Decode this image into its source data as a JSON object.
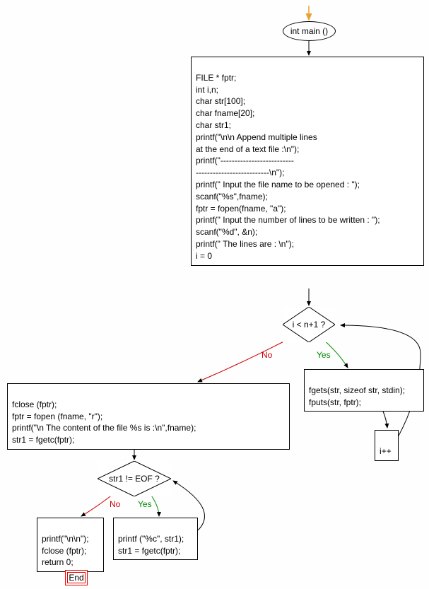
{
  "chart_data": {
    "type": "flowchart",
    "title": "C Program Flowchart: Append multiple lines at the end of a text file",
    "nodes": [
      {
        "id": "start",
        "type": "start-arrow"
      },
      {
        "id": "main",
        "type": "ellipse",
        "label": "int main ()"
      },
      {
        "id": "init",
        "type": "process",
        "label": "FILE * fptr;\nint i,n;\nchar str[100];\nchar fname[20];\nchar str1;\nprintf(\"\\n\\n Append multiple lines\nat the end of a text file :\\n\");\nprintf(\"--------------------------\n--------------------------\\n\");\nprintf(\" Input the file name to be opened : \");\nscanf(\"%s\",fname);\nfptr = fopen(fname, \"a\");\nprintf(\" Input the number of lines to be written : \");\nscanf(\"%d\", &n);\nprintf(\" The lines are : \\n\");\ni = 0"
      },
      {
        "id": "cond1",
        "type": "decision",
        "label": "i < n+1 ?"
      },
      {
        "id": "loop1",
        "type": "process",
        "label": "fgets(str, sizeof str, stdin);\nfputs(str, fptr);"
      },
      {
        "id": "incr",
        "type": "process",
        "label": "i++"
      },
      {
        "id": "afterloop",
        "type": "process",
        "label": "fclose (fptr);\nfptr = fopen (fname, \"r\");\nprintf(\"\\n The content of the file %s is  :\\n\",fname);\nstr1 = fgetc(fptr);"
      },
      {
        "id": "cond2",
        "type": "decision",
        "label": "str1 != EOF ?"
      },
      {
        "id": "loop2",
        "type": "process",
        "label": "printf (\"%c\", str1);\nstr1 = fgetc(fptr);"
      },
      {
        "id": "final",
        "type": "process",
        "label": "printf(\"\\n\\n\");\nfclose (fptr);\nreturn 0;"
      },
      {
        "id": "end",
        "type": "terminator",
        "label": "End"
      }
    ],
    "edges": [
      {
        "from": "start",
        "to": "main"
      },
      {
        "from": "main",
        "to": "init"
      },
      {
        "from": "init",
        "to": "cond1"
      },
      {
        "from": "cond1",
        "to": "loop1",
        "label": "Yes"
      },
      {
        "from": "loop1",
        "to": "incr"
      },
      {
        "from": "incr",
        "to": "cond1"
      },
      {
        "from": "cond1",
        "to": "afterloop",
        "label": "No"
      },
      {
        "from": "afterloop",
        "to": "cond2"
      },
      {
        "from": "cond2",
        "to": "loop2",
        "label": "Yes"
      },
      {
        "from": "loop2",
        "to": "cond2"
      },
      {
        "from": "cond2",
        "to": "final",
        "label": "No"
      },
      {
        "from": "final",
        "to": "end"
      }
    ]
  },
  "nodes": {
    "main": "int main ()",
    "init": "FILE * fptr;\nint i,n;\nchar str[100];\nchar fname[20];\nchar str1;\nprintf(\"\\n\\n Append multiple lines\nat the end of a text file :\\n\");\nprintf(\"--------------------------\n--------------------------\\n\");\nprintf(\" Input the file name to be opened : \");\nscanf(\"%s\",fname);\nfptr = fopen(fname, \"a\");\nprintf(\" Input the number of lines to be written : \");\nscanf(\"%d\", &n);\nprintf(\" The lines are : \\n\");\ni = 0",
    "cond1": "i < n+1 ?",
    "loop1": "fgets(str, sizeof str, stdin);\nfputs(str, fptr);",
    "incr": "i++",
    "afterloop": "fclose (fptr);\nfptr = fopen (fname, \"r\");\nprintf(\"\\n The content of the file %s is  :\\n\",fname);\nstr1 = fgetc(fptr);",
    "cond2": "str1 != EOF ?",
    "loop2": "printf (\"%c\", str1);\nstr1 = fgetc(fptr);",
    "final": "printf(\"\\n\\n\");\nfclose (fptr);\nreturn 0;",
    "end": "End"
  },
  "labels": {
    "yes1": "Yes",
    "no1": "No",
    "yes2": "Yes",
    "no2": "No"
  }
}
